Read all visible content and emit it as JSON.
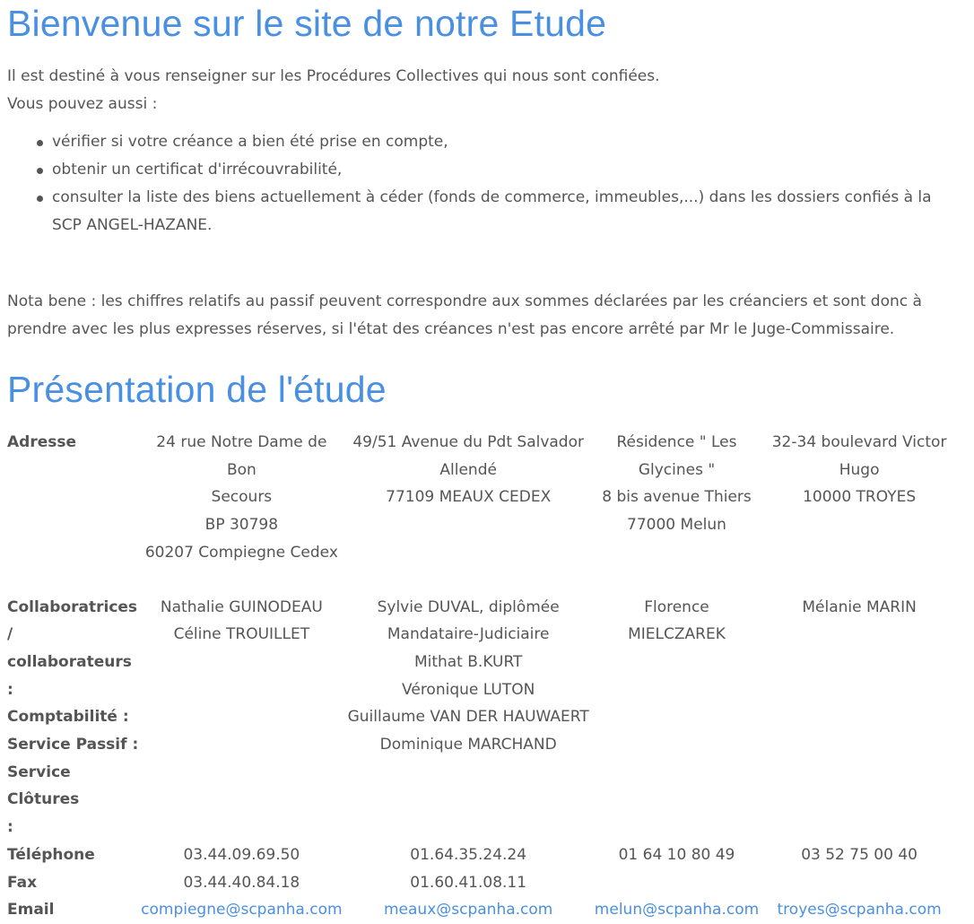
{
  "welcome": {
    "title": "Bienvenue sur le site de notre Etude",
    "intro1": "Il est destiné à vous renseigner sur les Procédures Collectives qui nous sont confiées.",
    "intro2": "Vous pouvez aussi :",
    "bullets": [
      "vérifier si votre créance a bien été prise en compte,",
      "obtenir un certificat d'irrécouvrabilité,",
      "consulter la liste des biens actuellement à céder (fonds de commerce, immeubles,...) dans les dossiers confiés à la SCP ANGEL-HAZANE."
    ],
    "nota": "Nota bene : les chiffres relatifs au passif peuvent correspondre aux sommes déclarées par les créanciers et sont donc à prendre avec les plus expresses réserves, si l'état des créances n'est pas encore arrêté par Mr le Juge-Commissaire."
  },
  "presentation": {
    "title": "Présentation de l'étude",
    "labels": {
      "address": "Adresse",
      "staff_lines": [
        "Collaboratrices",
        "/",
        "collaborateurs :",
        "Comptabilité :",
        "Service Passif :",
        "Service Clôtures",
        ":"
      ],
      "phone": "Téléphone",
      "fax": "Fax",
      "email": "Email"
    },
    "offices": [
      {
        "address": [
          "24 rue Notre Dame de Bon",
          "Secours",
          "BP 30798",
          "60207 Compiegne Cedex"
        ],
        "staff": [
          "Nathalie GUINODEAU",
          "Céline TROUILLET"
        ],
        "phone": "03.44.09.69.50",
        "fax": "03.44.40.84.18",
        "email": "compiegne@scpanha.com"
      },
      {
        "address": [
          "49/51 Avenue du Pdt Salvador",
          "Allendé",
          "77109 MEAUX CEDEX"
        ],
        "staff": [
          "Sylvie DUVAL, diplômée",
          "Mandataire-Judiciaire",
          "Mithat B.KURT",
          "Véronique LUTON",
          "Guillaume VAN DER HAUWAERT",
          "Dominique MARCHAND"
        ],
        "phone": "01.64.35.24.24",
        "fax": "01.60.41.08.11",
        "email": "meaux@scpanha.com"
      },
      {
        "address": [
          "Résidence \" Les",
          "Glycines \"",
          "8 bis avenue Thiers",
          "77000 Melun"
        ],
        "staff": [
          "Florence MIELCZAREK"
        ],
        "phone": "01 64 10 80 49",
        "fax": "",
        "email": "melun@scpanha.com"
      },
      {
        "address": [
          "32-34 boulevard Victor",
          "Hugo",
          "10000 TROYES"
        ],
        "staff": [
          "Mélanie MARIN"
        ],
        "phone": "03 52 75 00 40",
        "fax": "",
        "email": "troyes@scpanha.com"
      }
    ],
    "link_color": "#4a90e2",
    "heading_color": "#4a90e2"
  }
}
